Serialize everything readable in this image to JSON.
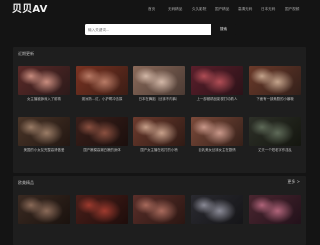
{
  "site": {
    "logo": "贝贝AV"
  },
  "nav": {
    "items": [
      "首页",
      "无码精品",
      "久久影院",
      "国产精品",
      "高清无码",
      "日本无码",
      "国产视频"
    ]
  },
  "search": {
    "placeholder": "输入关键词...",
    "button_label": "搜索"
  },
  "sections": [
    {
      "title": "近期更新",
      "more": "",
      "cards": [
        {
          "caption": "女主播被舔深入了射精",
          "colors": [
            "#5a2a28",
            "#c98d7f",
            "#2c1a1a"
          ]
        },
        {
          "caption": "澳洲熟…红，小护啊冲击摸",
          "colors": [
            "#7a3322",
            "#b87b66",
            "#3b1d15"
          ]
        },
        {
          "caption": "日本在舞蹈（丝袜不内裤）",
          "colors": [
            "#8a6a5a",
            "#d2b7a7",
            "#4b3a33"
          ]
        },
        {
          "caption": "上一部都精品影视打动着人",
          "colors": [
            "#5a1f2b",
            "#b04d55",
            "#2b1218"
          ]
        },
        {
          "caption": "下面有一部美剧的小暴哦",
          "colors": [
            "#6b3a2a",
            "#c4a48c",
            "#33201a"
          ]
        },
        {
          "caption": "美国的小女友完整高清做爱",
          "colors": [
            "#4a3528",
            "#9a7c66",
            "#221712"
          ]
        },
        {
          "caption": "国产嫩模高潮白嫩的身体",
          "colors": [
            "#3a1f1a",
            "#8a5040",
            "#1b0f0d"
          ]
        },
        {
          "caption": "国产女主播在线打的小喷",
          "colors": [
            "#6c3b2e",
            "#c7a08a",
            "#2f1a14"
          ]
        },
        {
          "caption": "巨乳美女丝袜女主在剧情",
          "colors": [
            "#7b4a3a",
            "#c9988a",
            "#352019"
          ]
        },
        {
          "caption": "丈夫一个短老字作淫乱",
          "colors": [
            "#2d3028",
            "#5e6a58",
            "#14160f"
          ]
        }
      ]
    },
    {
      "title": "欧美精品",
      "more": "更多 >",
      "cards": [
        {
          "caption": "",
          "colors": [
            "#3a2a22",
            "#8a6a58",
            "#1a120e"
          ]
        },
        {
          "caption": "",
          "colors": [
            "#4a1f1a",
            "#9e3a2e",
            "#1e0d0b"
          ]
        },
        {
          "caption": "",
          "colors": [
            "#5a2f2a",
            "#a86a5c",
            "#2a1612"
          ]
        },
        {
          "caption": "",
          "colors": [
            "#2a2a30",
            "#8a8a96",
            "#151518"
          ]
        },
        {
          "caption": "",
          "colors": [
            "#4a2630",
            "#b0647a",
            "#22111a"
          ]
        }
      ]
    }
  ]
}
